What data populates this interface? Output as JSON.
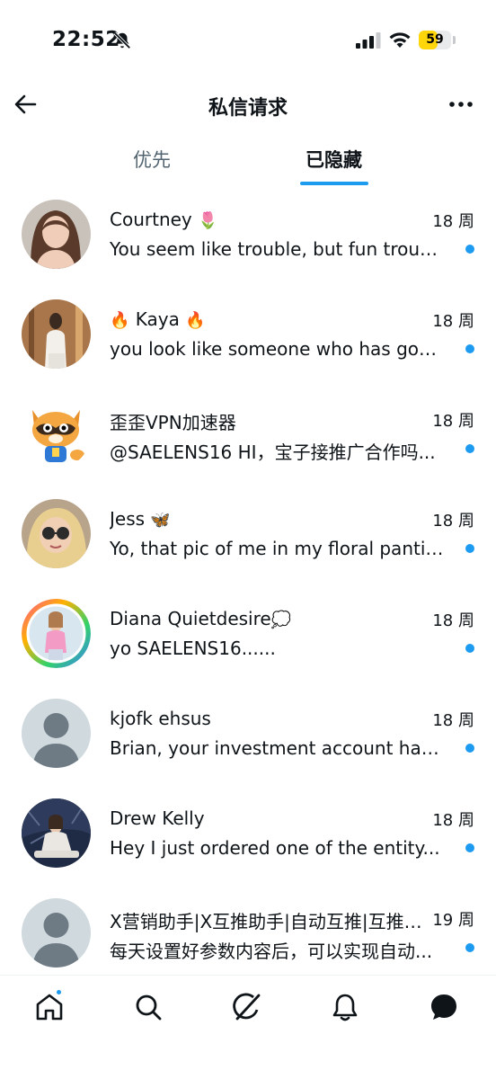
{
  "status_bar": {
    "time": "22:52",
    "battery_level": "59",
    "battery_fraction": 0.59,
    "battery_color": "#ffd60a",
    "icons": [
      "bell-slash-icon",
      "signal-icon",
      "wifi-icon",
      "battery-icon"
    ]
  },
  "header": {
    "title": "私信请求",
    "back_icon": "arrow-left-icon",
    "more_icon": "ellipsis-icon"
  },
  "tabs": [
    {
      "label": "优先",
      "active": false
    },
    {
      "label": "已隐藏",
      "active": true
    }
  ],
  "accent_color": "#1d9bf0",
  "messages": [
    {
      "name": "Courtney",
      "emoji": "🌷",
      "time": "18 周",
      "preview": "You seem like trouble, but fun trouble...",
      "unread": true,
      "avatar": "photo"
    },
    {
      "name": "Kaya",
      "emoji_before": "🔥",
      "emoji": "🔥",
      "time": "18 周",
      "preview": "you look like someone who has good taste...",
      "unread": true,
      "avatar": "photo"
    },
    {
      "name": "歪歪VPN加速器",
      "time": "18 周",
      "preview": "@SAELENS16 HI，宝子接推广合作吗...",
      "unread": true,
      "avatar": "raccoon-mascot"
    },
    {
      "name": "Jess",
      "emoji": "🦋",
      "time": "18 周",
      "preview": "Yo, that pic of me in my floral panties...",
      "unread": true,
      "avatar": "photo"
    },
    {
      "name": "Diana Quietdesire",
      "emoji": "💭",
      "time": "18 周",
      "preview": "yo SAELENS16......",
      "unread": true,
      "avatar": "photo-with-ring"
    },
    {
      "name": "kjofk ehsus",
      "time": "18 周",
      "preview": "Brian, your investment account has been...",
      "unread": true,
      "avatar": "default"
    },
    {
      "name": "Drew Kelly",
      "time": "18 周",
      "preview": "Hey I just ordered one of the entity...",
      "unread": true,
      "avatar": "photo"
    },
    {
      "name": "X营销助手|X互推助手|自动互推|互推助手",
      "time": "19 周",
      "preview": "每天设置好参数内容后，可以实现自动...",
      "unread": true,
      "avatar": "default"
    }
  ],
  "bottom_nav": {
    "items": [
      "home-icon",
      "search-icon",
      "grok-icon",
      "notifications-icon",
      "messages-icon"
    ],
    "home_has_badge": true
  }
}
